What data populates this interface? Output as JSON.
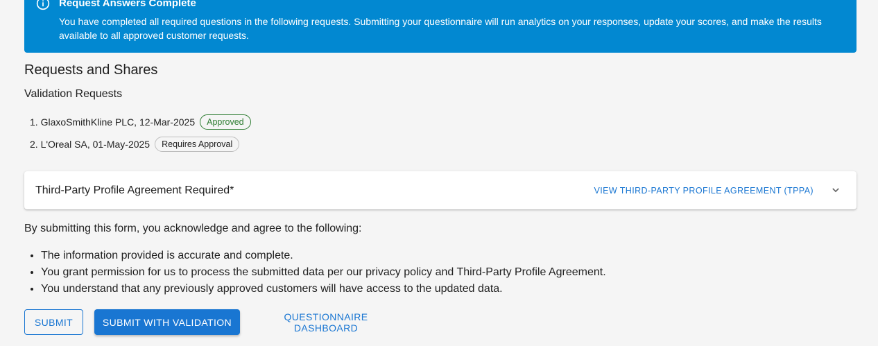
{
  "alert": {
    "icon": "info-icon",
    "title": "Request Answers Complete",
    "body": "You have completed all required questions in the following requests. Submitting your questionnaire will run analytics on your responses, update your scores, and make the results available to all approved customer requests.",
    "color": "#0288d1"
  },
  "main": {
    "heading": "Requests and Shares",
    "validation_heading": "Validation Requests",
    "requests": [
      {
        "text": "1. GlaxoSmithKline PLC, 12-Mar-2025",
        "status": "Approved"
      },
      {
        "text": "2. L'Oreal SA, 01-May-2025",
        "status": "Requires Approval"
      }
    ]
  },
  "agreement": {
    "title": "Third-Party Profile Agreement Required*",
    "link_label": "VIEW THIRD-PARTY PROFILE AGREEMENT (TPPA)",
    "expand_icon": "chevron-down-icon"
  },
  "acknowledgement": {
    "intro": "By submitting this form, you acknowledge and agree to the following:",
    "items": [
      "The information provided is accurate and complete.",
      "You grant permission for us to process the submitted data per our privacy policy and Third-Party Profile Agreement.",
      "You understand that any previously approved customers will have access to the updated data."
    ]
  },
  "actions": {
    "submit_label": "SUBMIT",
    "submit_validation_label": "SUBMIT WITH VALIDATION",
    "dashboard_label": "QUESTIONNAIRE DASHBOARD",
    "primary_color": "#1976d2"
  }
}
